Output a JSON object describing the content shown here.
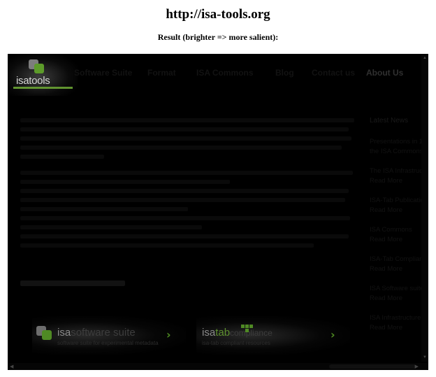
{
  "page": {
    "url_title": "http://isa-tools.org",
    "result_caption": "Result (brighter => more salient):"
  },
  "header": {
    "logo_text": "isatools",
    "nav": [
      {
        "label": "Software Suite"
      },
      {
        "label": "Format"
      },
      {
        "label": "ISA Commons"
      },
      {
        "label": "Blog"
      },
      {
        "label": "Contact us"
      },
      {
        "label": "About Us"
      }
    ]
  },
  "sidebar": {
    "title": "Latest News",
    "items": [
      {
        "label": "Presentations in 1",
        "label2": "the ISA Commons"
      },
      {
        "label": "The ISA Infrastruct",
        "label2": "Read More"
      },
      {
        "label": "ISA-Tab Publication",
        "label2": "Read More"
      },
      {
        "label": "ISA Commons",
        "label2": "Read More"
      },
      {
        "label": "ISA-Tab Compliance",
        "label2": "Read More"
      },
      {
        "label": "ISA Software suite",
        "label2": "Read More"
      },
      {
        "label": "ISA Infrastructure",
        "label2": "Read More"
      }
    ]
  },
  "banners": {
    "software_suite": {
      "brand": "isa",
      "rest": "software suite",
      "sub": "software suite for experimental metadata"
    },
    "isatab_compliance": {
      "brand": "isa",
      "accent": "tab",
      "rest": "compliance",
      "sub": "isa-tab compliant resources"
    }
  },
  "colors": {
    "background": "#000000",
    "brand_green": "#6aa334"
  }
}
